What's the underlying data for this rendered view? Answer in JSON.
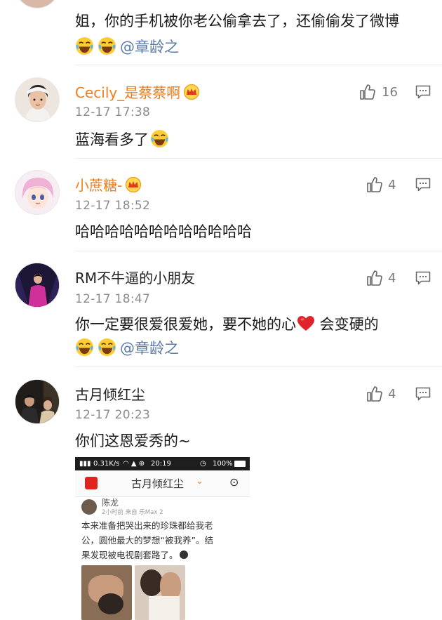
{
  "top_comment": {
    "line1": "姐，你的手机被你老公偷拿去了，还偷偷发了微博",
    "mention": "@章龄之",
    "emojis": [
      "laugh-cry-emoji",
      "laugh-cry-emoji"
    ]
  },
  "comments": [
    {
      "username": "Cecily_是蔡蔡啊",
      "vip": true,
      "time": "12-17 17:38",
      "likes": "16",
      "text": "蓝海看多了",
      "avatar_icon": "girl-avatar"
    },
    {
      "username": "小蔗糖-",
      "vip": true,
      "time": "12-17 18:52",
      "likes": "4",
      "text": "哈哈哈哈哈哈哈哈哈哈哈哈",
      "avatar_icon": "cartoon-avatar"
    },
    {
      "username": "RM不牛逼的小朋友",
      "vip": false,
      "time": "12-17 18:47",
      "likes": "4",
      "text_before_heart": "你一定要很爱很爱她，要不她的心",
      "text_after_heart": " 会变硬的",
      "mention": "@章龄之",
      "avatar_icon": "stage-avatar"
    },
    {
      "username": "古月倾红尘",
      "vip": false,
      "time": "12-17 20:23",
      "likes": "4",
      "text": "你们这恩爱秀的~",
      "avatar_icon": "couple-avatar"
    }
  ],
  "embedded_screenshot": {
    "status_left": "0.31K/s",
    "status_time": "20:19",
    "status_battery": "100%",
    "nav_title": "古月倾红尘",
    "post_author": "陈龙",
    "post_meta": "2小时前  来自 乐Max 2",
    "post_lines": [
      "本来准备把哭出来的珍珠都给我老",
      "公，圆他最大的梦想“被我养”。结",
      "果发现被电视剧套路了。"
    ]
  },
  "colors": {
    "vip_name": "#f07d1a",
    "mention": "#5b7aa6",
    "time": "#8c8c8c",
    "divider": "#ececec"
  }
}
